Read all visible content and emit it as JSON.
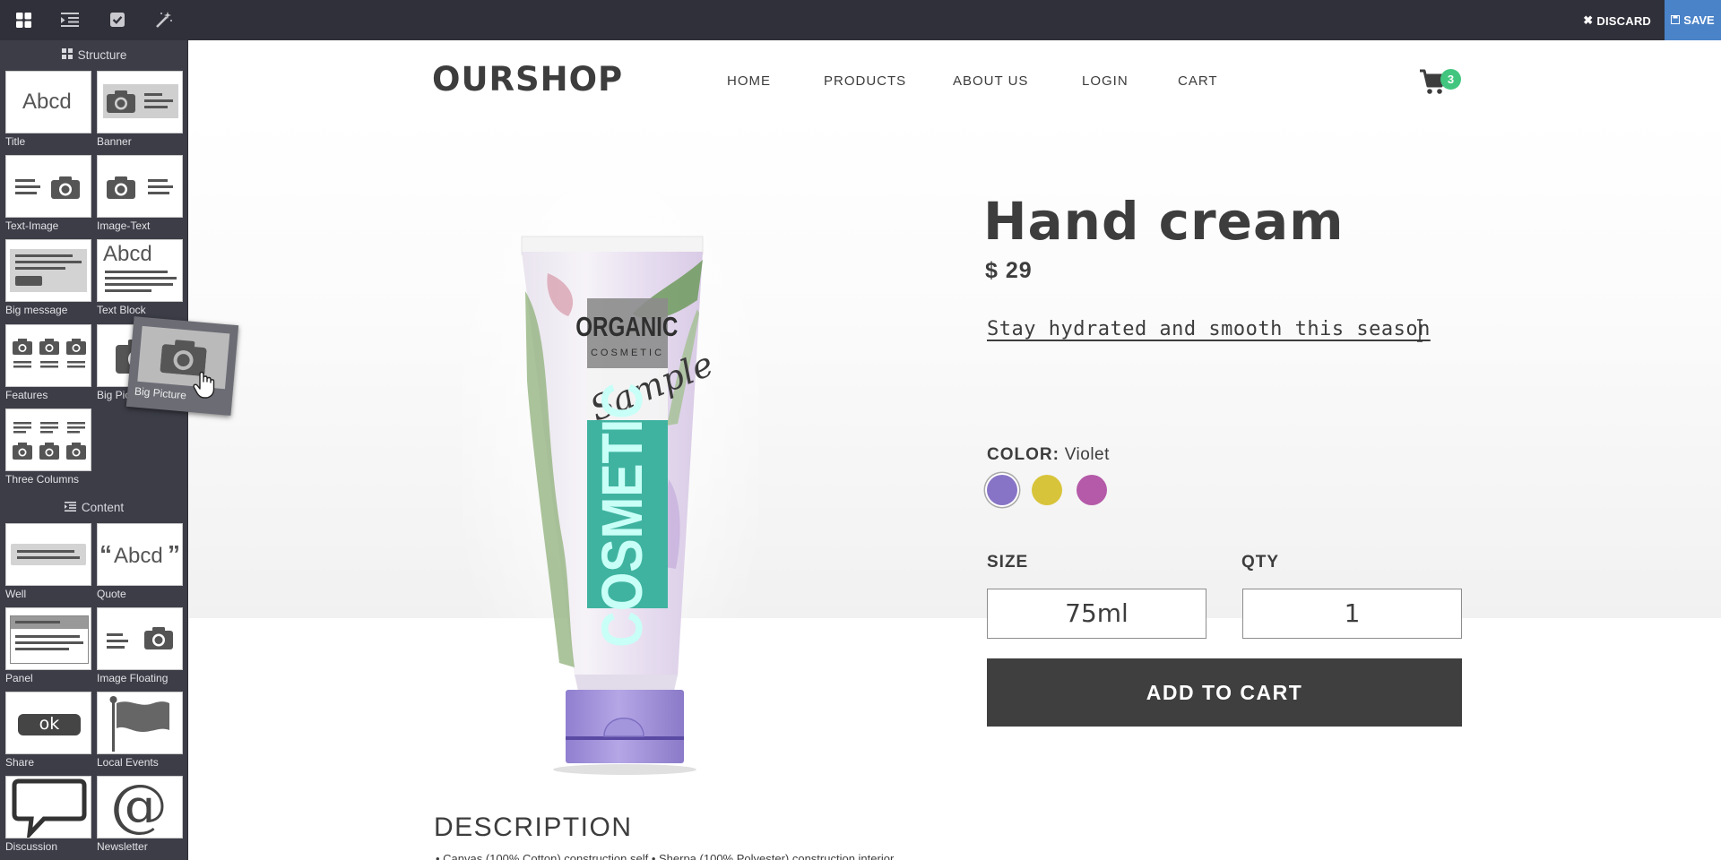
{
  "editor": {
    "tools": [
      {
        "name": "snippets-tool",
        "icon": "grid-icon"
      },
      {
        "name": "outline-tool",
        "icon": "indent-list-icon"
      },
      {
        "name": "checklist-tool",
        "icon": "checkbox-icon"
      },
      {
        "name": "magic-tool",
        "icon": "magic-wand-icon"
      }
    ],
    "discard_label": "DISCARD",
    "save_label": "SAVE"
  },
  "sidebar": {
    "structure_header": "Structure",
    "content_header": "Content",
    "structure_snippets": [
      "Title",
      "Banner",
      "Text-Image",
      "Image-Text",
      "Big message",
      "Text Block",
      "Features",
      "Big Picture",
      "Three Columns"
    ],
    "content_snippets": [
      "Well",
      "Quote",
      "Panel",
      "Image Floating",
      "Share",
      "Local Events",
      "Discussion",
      "Newsletter"
    ],
    "thumb_text": {
      "abcd": "Abcd",
      "quote_abcd": "Abcd",
      "ok": "ok",
      "at": "@"
    },
    "dragging_label": "Big Picture"
  },
  "site": {
    "brand": "OURSHOP",
    "nav": [
      "HOME",
      "PRODUCTS",
      "ABOUT US",
      "LOGIN",
      "CART"
    ],
    "cart_count": "3"
  },
  "product": {
    "title": "Hand cream",
    "price": "$ 29",
    "tagline": "Stay hydrated and smooth this season",
    "color_label": "COLOR:",
    "color_value": "Violet",
    "swatches": [
      "#8874c6",
      "#d8c43a",
      "#b45aa8"
    ],
    "size_label": "SIZE",
    "size_value": "75ml",
    "qty_label": "QTY",
    "qty_value": "1",
    "add_to_cart_label": "ADD TO CART",
    "image_text": {
      "organic": "ORGANIC",
      "cosmetic_small": "COSMETIC",
      "sample": "Sample",
      "cosmetic_big": "COSMETIC"
    }
  },
  "description": {
    "heading": "DESCRIPTION",
    "text": "• Canvas (100% Cotton) construction self • Sherpa (100% Polyester) construction interior"
  }
}
